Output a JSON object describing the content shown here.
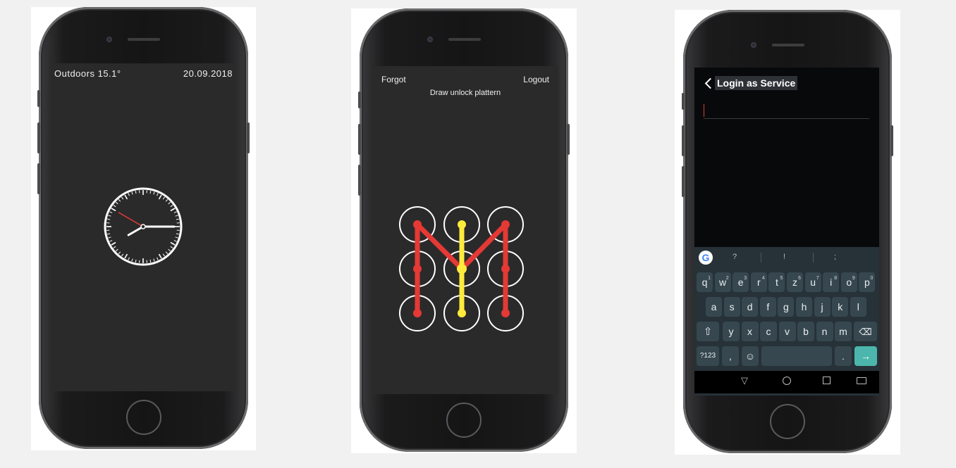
{
  "phone1": {
    "weather": "Outdoors 15.1°",
    "date": "20.09.2018",
    "clock": {
      "hour": 3,
      "minute": 40,
      "second": 50
    }
  },
  "phone2": {
    "forgot": "Forgot",
    "logout": "Logout",
    "hint": "Draw unlock plattern",
    "colors": {
      "pattern_main": "#e53935",
      "pattern_accent": "#ffeb3b"
    }
  },
  "phone3": {
    "title": "Login as Service",
    "suggestions": [
      "?",
      "!",
      ";"
    ],
    "keyboard": {
      "row1": [
        {
          "k": "q",
          "s": "1"
        },
        {
          "k": "w",
          "s": "2"
        },
        {
          "k": "e",
          "s": "3"
        },
        {
          "k": "r",
          "s": "4"
        },
        {
          "k": "t",
          "s": "5"
        },
        {
          "k": "z",
          "s": "6"
        },
        {
          "k": "u",
          "s": "7"
        },
        {
          "k": "i",
          "s": "8"
        },
        {
          "k": "o",
          "s": "9"
        },
        {
          "k": "p",
          "s": "0"
        }
      ],
      "row2": [
        "a",
        "s",
        "d",
        "f",
        "g",
        "h",
        "j",
        "k",
        "l"
      ],
      "row3": [
        "y",
        "x",
        "c",
        "v",
        "b",
        "n",
        "m"
      ],
      "sym_label": "?123",
      "comma": ",",
      "period": "."
    }
  }
}
